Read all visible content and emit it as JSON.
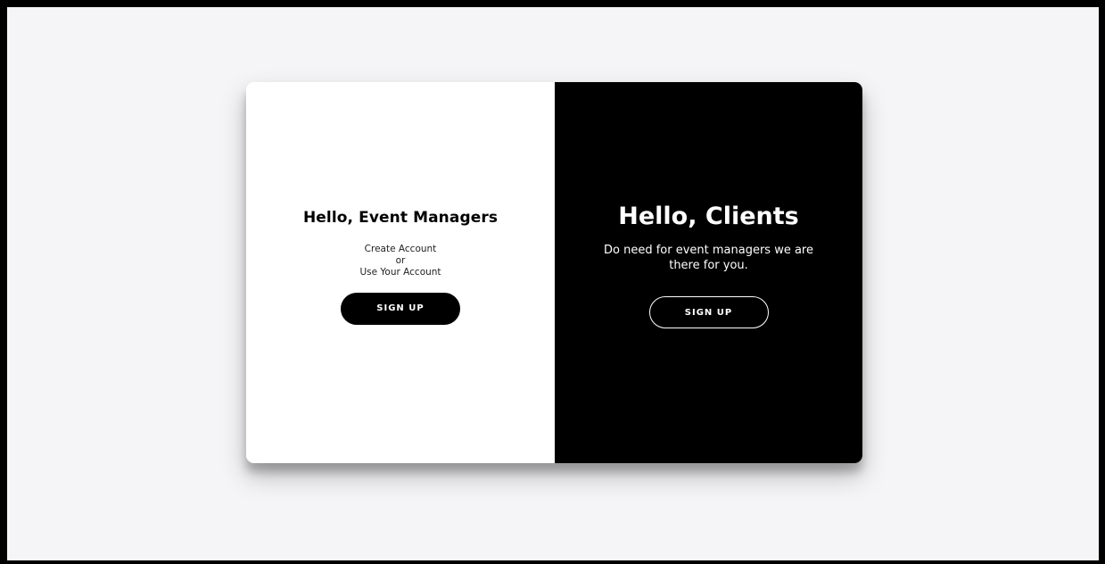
{
  "left_panel": {
    "title": "Hello, Event Managers",
    "line1": "Create Account",
    "line2": "or",
    "line3": "Use Your Account",
    "button_label": "SIGN UP"
  },
  "right_panel": {
    "title": "Hello, Clients",
    "description": "Do need for event managers we are there for you.",
    "button_label": "SIGN UP"
  },
  "colors": {
    "page_background": "#f5f5f7",
    "dark": "#000000",
    "light": "#ffffff"
  }
}
